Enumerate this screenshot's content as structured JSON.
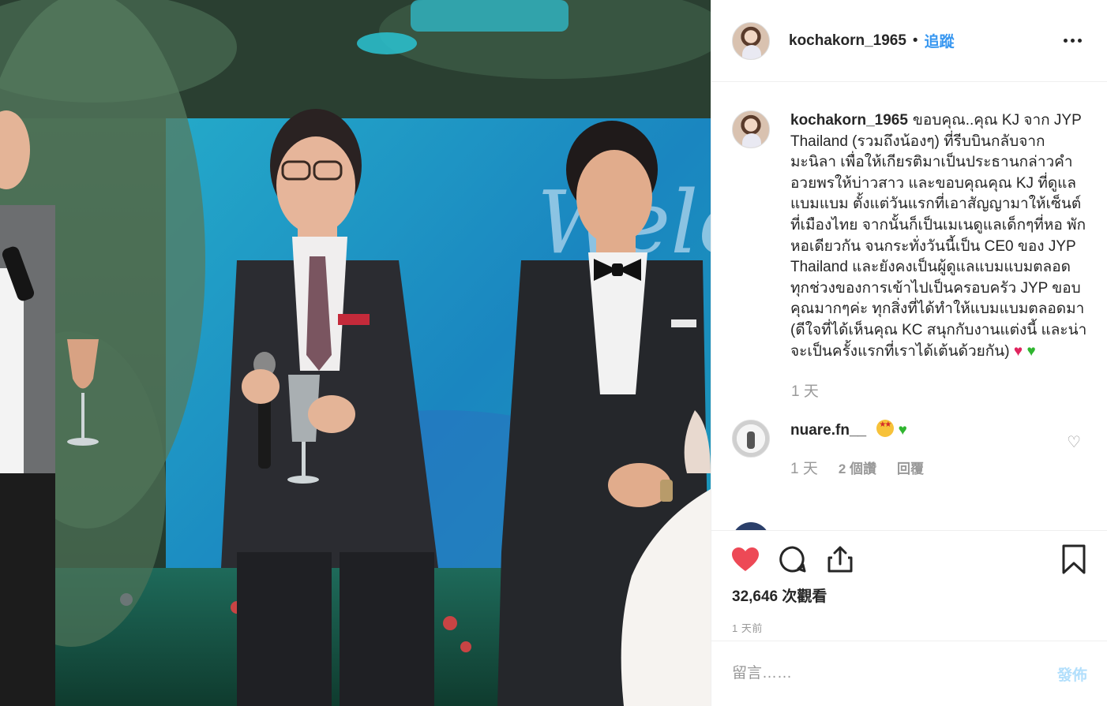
{
  "post": {
    "username": "kochakorn_1965",
    "separator": "•",
    "follow_label": "追蹤",
    "caption": "ขอบคุณ..คุณ KJ จาก JYP Thailand (รวมถึงน้องๆ) ที่รีบบินกลับจากมะนิลา เพื่อให้เกียรติมาเป็นประธานกล่าวคำอวยพรให้บ่าวสาว และขอบคุณคุณ KJ ที่ดูแลแบมแบม ตั้งแต่วันแรกที่เอาสัญญามาให้เซ็นต์ที่เมืองไทย จากนั้นก็เป็นเมเนดูแลเด็กๆที่หอ พักหอเดียวกัน จนกระทั่งวันนี้เป็น CE0 ของ JYP Thailand และยังคงเป็นผู้ดูแลแบมแบมตลอดทุกช่วงของการเข้าไปเป็นครอบครัว JYP ขอบคุณมากๆค่ะ ทุกสิ่งที่ได้ทำให้แบมแบมตลอดมา (ดีใจที่ได้เห็นคุณ KC สนุกกับงานแต่งนี้ และน่าจะเป็นครั้งแรกที่เราได้เต้นด้วยกัน)",
    "caption_hearts": [
      "♥",
      "♥"
    ],
    "caption_time": "1 天",
    "views": "32,646 次觀看",
    "posted_time": "1 天前"
  },
  "comments": [
    {
      "username": "nuare.fn__",
      "text_heart": "♥",
      "time": "1 天",
      "likes": "2 個讚",
      "reply": "回覆"
    }
  ],
  "actions": {
    "like_icon": "heart-filled-icon",
    "comment_icon": "comment-icon",
    "share_icon": "share-icon",
    "save_icon": "bookmark-icon"
  },
  "composer": {
    "placeholder": "留言……",
    "post_label": "發佈"
  },
  "colors": {
    "accent": "#3897f0",
    "like": "#ed4956",
    "muted": "#999999"
  }
}
